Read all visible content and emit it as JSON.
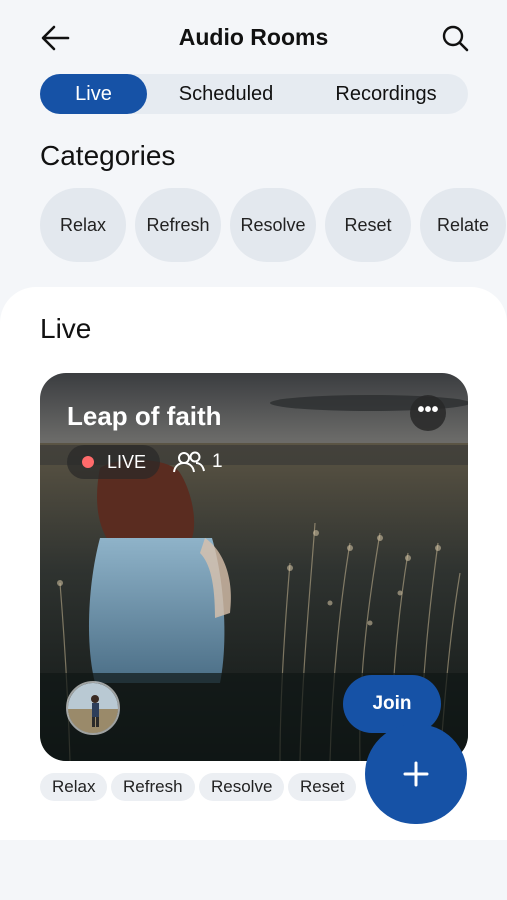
{
  "header": {
    "title": "Audio Rooms"
  },
  "tabs": [
    {
      "label": "Live",
      "active": true
    },
    {
      "label": "Scheduled",
      "active": false
    },
    {
      "label": "Recordings",
      "active": false
    }
  ],
  "categories": {
    "heading": "Categories",
    "items": [
      "Relax",
      "Refresh",
      "Resolve",
      "Reset",
      "Relate"
    ]
  },
  "live_section": {
    "heading": "Live",
    "room": {
      "title": "Leap of faith",
      "status": "LIVE",
      "listeners": "1",
      "join_label": "Join",
      "more_label": "•••",
      "tags": [
        "Relax",
        "Refresh",
        "Resolve",
        "Reset"
      ]
    }
  },
  "fab": {
    "icon": "plus-icon"
  },
  "colors": {
    "accent": "#1652a6",
    "live_dot": "#ff6b6b",
    "chip_bg": "#e3e8ee",
    "page_bg": "#f4f6f9"
  }
}
